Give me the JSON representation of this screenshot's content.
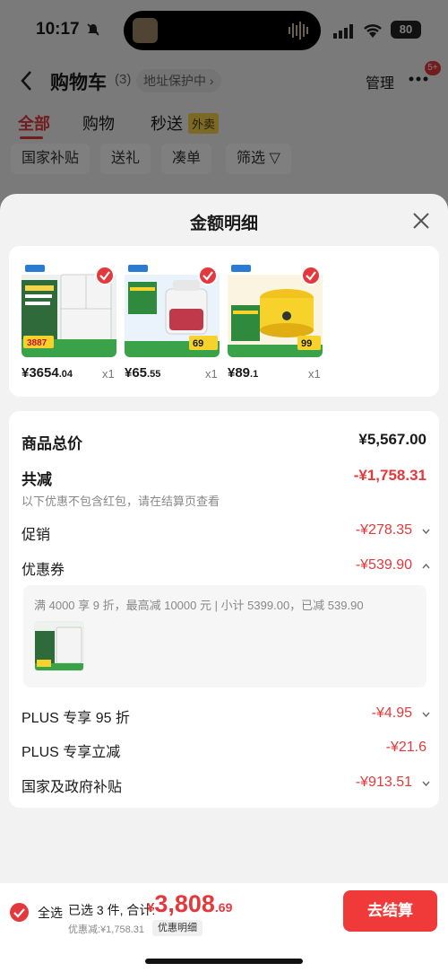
{
  "status_bar": {
    "time": "10:17",
    "battery": "80"
  },
  "header": {
    "title": "购物车",
    "count": "(3)",
    "address_tag": "地址保护中 ›",
    "manage": "管理",
    "more_badge": "5+"
  },
  "tabs": [
    {
      "label": "全部",
      "active": true
    },
    {
      "label": "购物",
      "active": false
    },
    {
      "label": "秒送",
      "active": false
    }
  ],
  "tab_badge": "外卖",
  "filters": [
    "国家补贴",
    "送礼",
    "凑单",
    "筛选 ▽"
  ],
  "sheet": {
    "title": "金额明细",
    "products": [
      {
        "price_int": "¥3654",
        "price_dec": ".04",
        "qty": "x1",
        "thumb_tag": "3887"
      },
      {
        "price_int": "¥65",
        "price_dec": ".55",
        "qty": "x1",
        "thumb_tag": "69"
      },
      {
        "price_int": "¥89",
        "price_dec": ".1",
        "qty": "x1",
        "thumb_tag": "99"
      }
    ],
    "rows": {
      "total_label": "商品总价",
      "total_value": "¥5,567.00",
      "discount_label": "共减",
      "discount_value": "-¥1,758.31",
      "discount_note": "以下优惠不包含红包，请在结算页查看",
      "promo_label": "促销",
      "promo_value": "-¥278.35",
      "coupon_label": "优惠券",
      "coupon_value": "-¥539.90",
      "coupon_detail": "满 4000 享 9 折，最高减 10000 元 | 小计 5399.00，已减 539.90",
      "plus95_label": "PLUS 专享 95 折",
      "plus95_value": "-¥4.95",
      "plus_direct_label": "PLUS 专享立减",
      "plus_direct_value": "-¥21.6",
      "gov_label": "国家及政府补贴",
      "gov_value": "-¥913.51"
    }
  },
  "bottom_bar": {
    "select_all": "全选",
    "selected_text": "已选 3 件, 合计:",
    "total_yen": "¥",
    "total_int": "3,808",
    "total_dec": ".69",
    "saved_text": "优惠减:¥1,758.31",
    "detail_button": "优惠明细",
    "checkout_button": "去结算"
  },
  "colors": {
    "accent": "#e4393c",
    "checkout": "#f03a3a"
  }
}
